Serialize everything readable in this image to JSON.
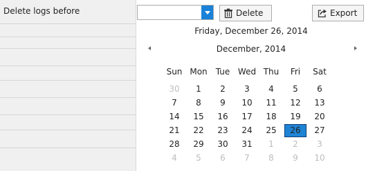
{
  "filter": {
    "label": "Delete logs before"
  },
  "toolbar": {
    "delete_label": "Delete",
    "export_label": "Export"
  },
  "calendar": {
    "today_text": "Friday, December 26, 2014",
    "month_title": "December, 2014",
    "weekdays": [
      "Sun",
      "Mon",
      "Tue",
      "Wed",
      "Thu",
      "Fri",
      "Sat"
    ],
    "weeks": [
      [
        "30",
        "1",
        "2",
        "3",
        "4",
        "5",
        "6"
      ],
      [
        "7",
        "8",
        "9",
        "10",
        "11",
        "12",
        "13"
      ],
      [
        "14",
        "15",
        "16",
        "17",
        "18",
        "19",
        "20"
      ],
      [
        "21",
        "22",
        "23",
        "24",
        "25",
        "26",
        "27"
      ],
      [
        "28",
        "29",
        "30",
        "31",
        "1",
        "2",
        "3"
      ],
      [
        "4",
        "5",
        "6",
        "7",
        "8",
        "9",
        "10"
      ]
    ],
    "selected_day": "26"
  },
  "colors": {
    "accent": "#1f83d4",
    "dropdown_button": "#1982d8",
    "muted_day": "#bdbdbd"
  }
}
